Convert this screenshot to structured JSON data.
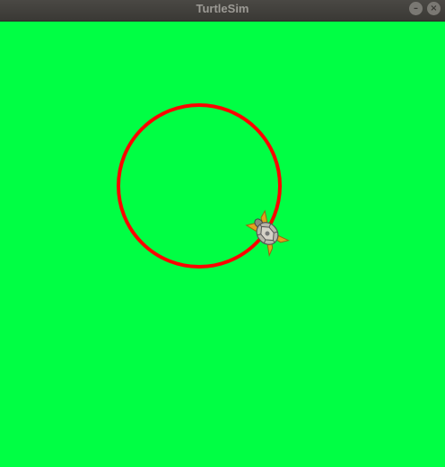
{
  "window": {
    "title": "TurtleSim",
    "minimize_glyph": "–",
    "close_glyph": "×"
  },
  "canvas": {
    "background_color": "#00ff44",
    "pen_color": "#ff0000"
  },
  "turtle": {
    "icon": "turtle-icon",
    "heading": "down-right"
  }
}
